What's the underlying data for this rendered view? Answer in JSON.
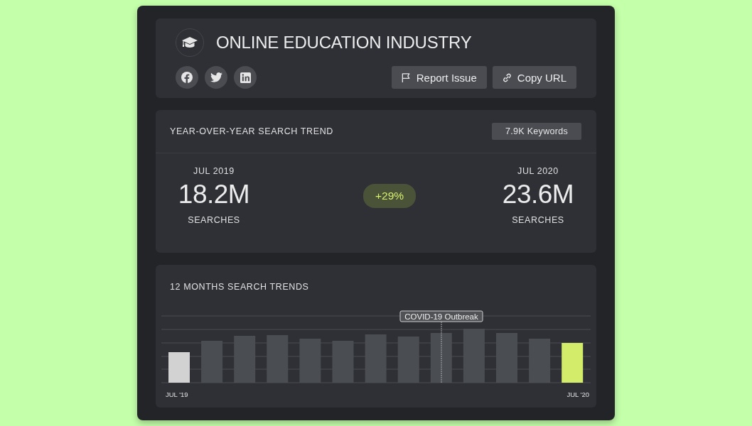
{
  "header": {
    "title": "ONLINE EDUCATION INDUSTRY",
    "social": [
      {
        "kind": "facebook"
      },
      {
        "kind": "twitter"
      },
      {
        "kind": "linkedin"
      }
    ],
    "buttons": [
      {
        "kind": "flag",
        "label": "Report Issue"
      },
      {
        "kind": "link",
        "label": "Copy URL"
      }
    ]
  },
  "trend": {
    "title": "YEAR-OVER-YEAR SEARCH TREND",
    "keywords": "7.9K Keywords",
    "from": {
      "period": "JUL 2019",
      "value": "18.2M",
      "unit": "SEARCHES"
    },
    "change": "+29%",
    "to": {
      "period": "JUL 2020",
      "value": "23.6M",
      "unit": "SEARCHES"
    }
  },
  "chart": {
    "title": "12 MONTHS SEARCH TRENDS",
    "annotation": "COVID-19 Outbreak",
    "start_label": "JUL '19",
    "end_label": "JUL '20"
  }
}
